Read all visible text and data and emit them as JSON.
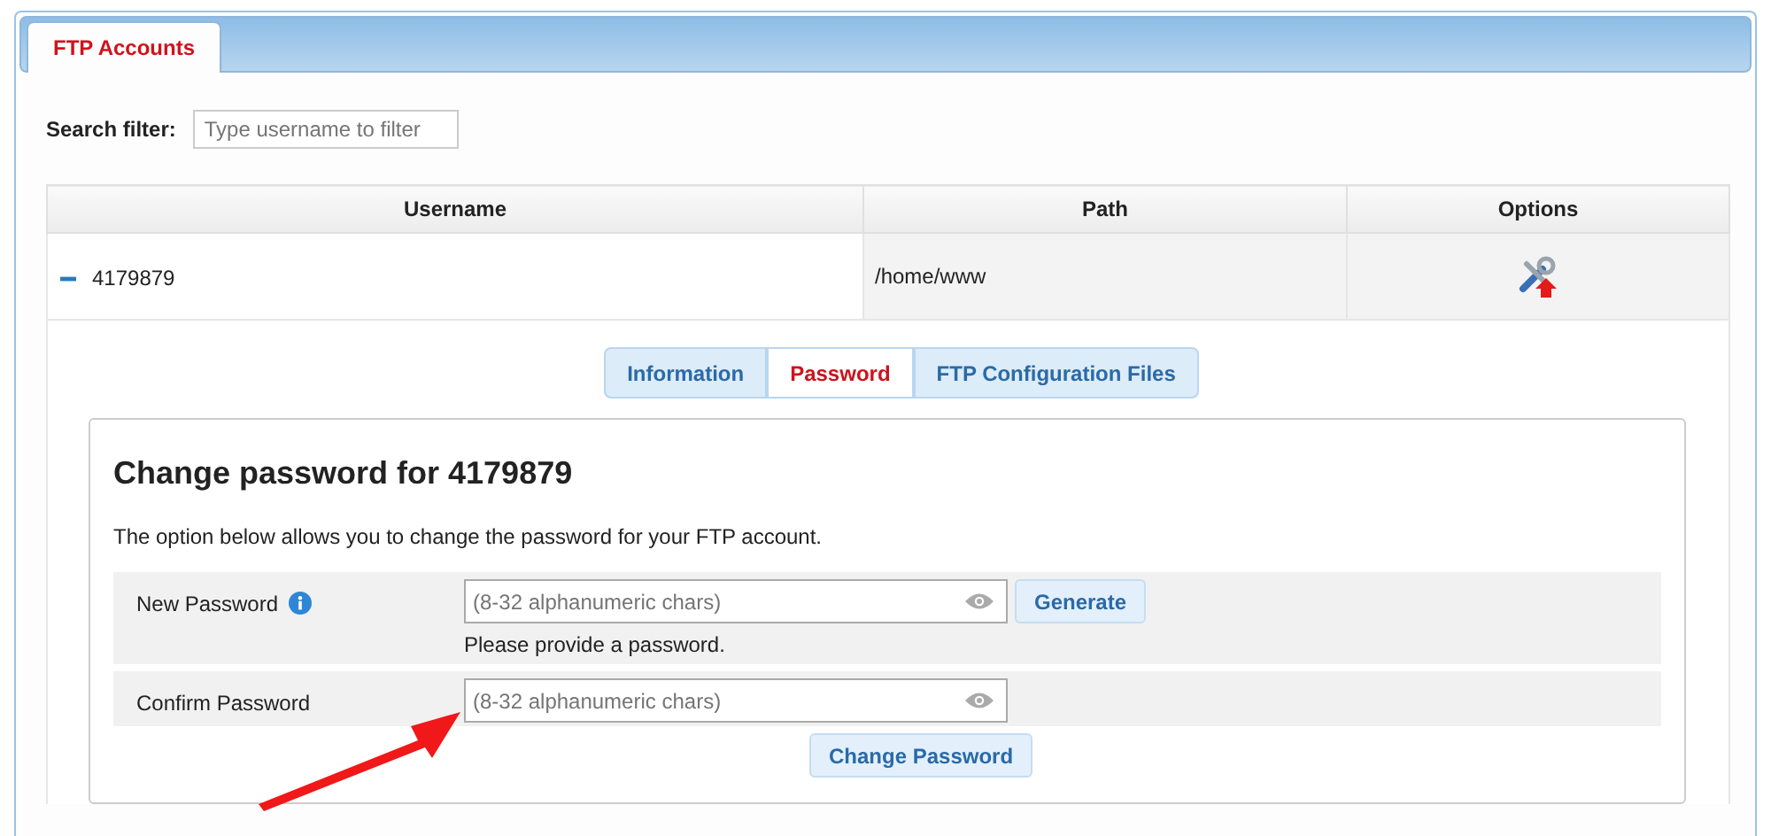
{
  "tabs": [
    {
      "label": "FTP Accounts",
      "selected": true
    }
  ],
  "search": {
    "label": "Search filter:",
    "placeholder": "Type username to filter"
  },
  "table": {
    "columns": [
      "Username",
      "Path",
      "Options"
    ],
    "rows": [
      {
        "username": "4179879",
        "path": "/home/www",
        "expanded": true
      }
    ]
  },
  "detail_tabs": [
    {
      "label": "Information",
      "selected": false
    },
    {
      "label": "Password",
      "selected": true
    },
    {
      "label": "FTP Configuration Files",
      "selected": false
    }
  ],
  "form": {
    "title": "Change password for 4179879",
    "description": "The option below allows you to change the password for your FTP account.",
    "fields": [
      {
        "label": "New Password",
        "info": true,
        "placeholder": "(8-32 alphanumeric chars)",
        "hint": "Please provide a password.",
        "button": "Generate"
      },
      {
        "label": "Confirm Password",
        "info": false,
        "placeholder": "(8-32 alphanumeric chars)"
      }
    ],
    "submit": "Change Password"
  }
}
